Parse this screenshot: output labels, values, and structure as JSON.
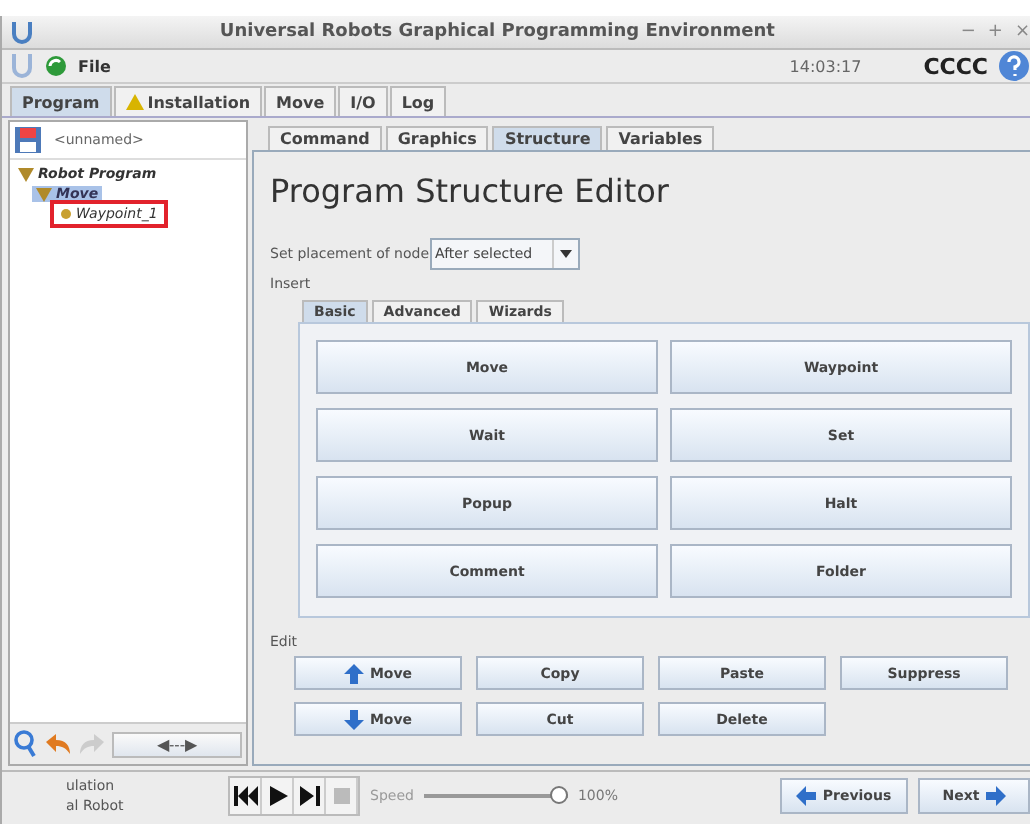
{
  "window": {
    "title": "Universal Robots Graphical Programming Environment",
    "controls": [
      "−",
      "+",
      "×"
    ]
  },
  "toolbar": {
    "menu": "File",
    "time": "14:03:17",
    "robot_name": "CCCC"
  },
  "main_tabs": [
    {
      "label": "Program",
      "selected": true,
      "warning": false
    },
    {
      "label": "Installation",
      "selected": false,
      "warning": true
    },
    {
      "label": "Move",
      "selected": false,
      "warning": false
    },
    {
      "label": "I/O",
      "selected": false,
      "warning": false
    },
    {
      "label": "Log",
      "selected": false,
      "warning": false
    }
  ],
  "program_tree": {
    "file_name": "<unnamed>",
    "nodes": [
      {
        "label": "Robot Program",
        "selected": false,
        "highlighted": false,
        "children": [
          {
            "label": "Move",
            "selected": true,
            "highlighted": false,
            "children": [
              {
                "label": "Waypoint_1",
                "selected": false,
                "highlighted": true
              }
            ]
          }
        ]
      }
    ],
    "nav_slider": "◀---▶"
  },
  "editor_tabs": [
    {
      "label": "Command",
      "selected": false
    },
    {
      "label": "Graphics",
      "selected": false
    },
    {
      "label": "Structure",
      "selected": true
    },
    {
      "label": "Variables",
      "selected": false
    }
  ],
  "editor": {
    "title": "Program Structure Editor",
    "placement_label": "Set placement of node",
    "placement_value": "After selected",
    "insert_label": "Insert",
    "insert_tabs": [
      {
        "label": "Basic",
        "selected": true
      },
      {
        "label": "Advanced",
        "selected": false
      },
      {
        "label": "Wizards",
        "selected": false
      }
    ],
    "insert_buttons": [
      "Move",
      "Waypoint",
      "Wait",
      "Set",
      "Popup",
      "Halt",
      "Comment",
      "Folder"
    ],
    "edit_label": "Edit",
    "edit_buttons": [
      {
        "label": "Move",
        "kind": "move_up"
      },
      {
        "label": "Copy",
        "kind": "plain"
      },
      {
        "label": "Paste",
        "kind": "plain"
      },
      {
        "label": "Suppress",
        "kind": "plain"
      },
      {
        "label": "Move",
        "kind": "move_down"
      },
      {
        "label": "Cut",
        "kind": "plain"
      },
      {
        "label": "Delete",
        "kind": "plain"
      }
    ]
  },
  "footer": {
    "mode_lines": [
      "ulation",
      "al Robot"
    ],
    "speed_label": "Speed",
    "speed": {
      "level": 0.95
    },
    "speed_reading": "100%",
    "previous": "Previous",
    "next": "Next"
  }
}
